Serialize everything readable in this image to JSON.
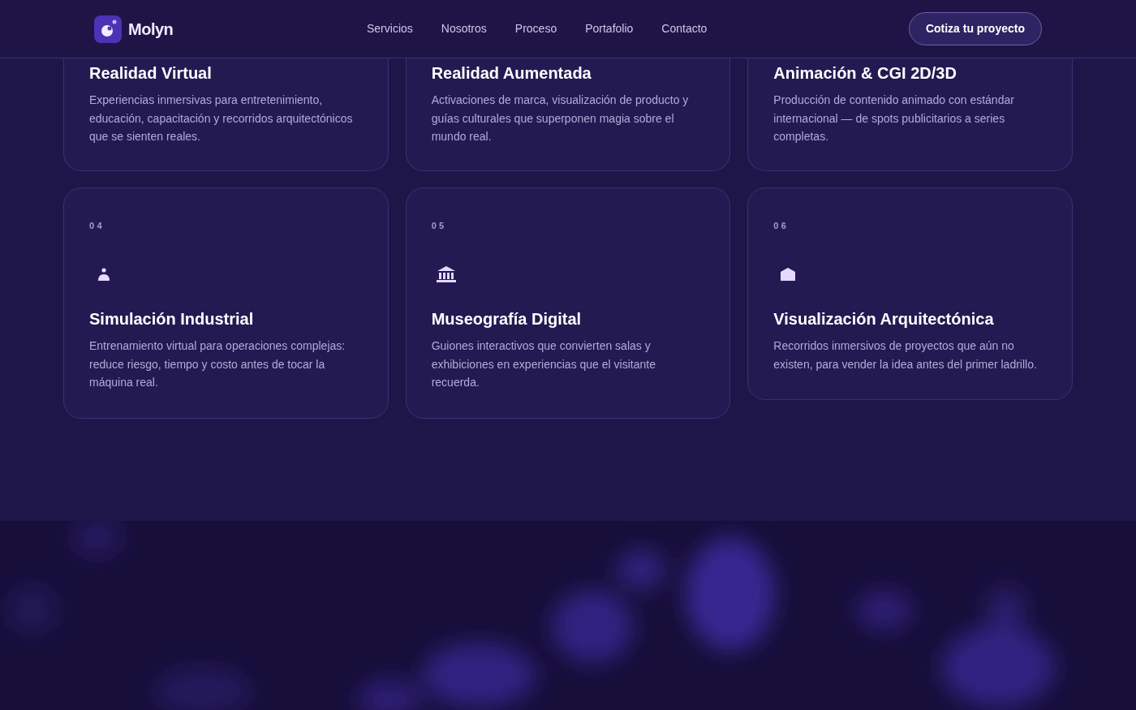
{
  "header": {
    "brand": "Molyn",
    "nav": [
      {
        "label": "Servicios"
      },
      {
        "label": "Nosotros"
      },
      {
        "label": "Proceso"
      },
      {
        "label": "Portafolio"
      },
      {
        "label": "Contacto"
      }
    ],
    "cta": "Cotiza tu proyecto"
  },
  "services": [
    {
      "title": "Realidad Virtual",
      "description": "Experiencias inmersivas para entretenimiento, educación, capacitación y recorridos arquitectónicos que se sienten reales."
    },
    {
      "title": "Realidad Aumentada",
      "description": "Activaciones de marca, visualización de producto y guías culturales que superponen magia sobre el mundo real."
    },
    {
      "title": "Animación & CGI 2D/3D",
      "description": "Producción de contenido animado con estándar internacional — de spots publicitarios a series completas."
    },
    {
      "number": "04",
      "title": "Simulación Industrial",
      "description": "Entrenamiento virtual para operaciones complejas: reduce riesgo, tiempo y costo antes de tocar la máquina real."
    },
    {
      "number": "05",
      "title": "Museografía Digital",
      "description": "Guiones interactivos que convierten salas y exhibiciones en experiencias que el visitante recuerda."
    },
    {
      "number": "06",
      "title": "Visualización Arquitectónica",
      "description": "Recorridos inmersivos de proyectos que aún no existen, para vender la idea antes del primer ladrillo."
    }
  ]
}
